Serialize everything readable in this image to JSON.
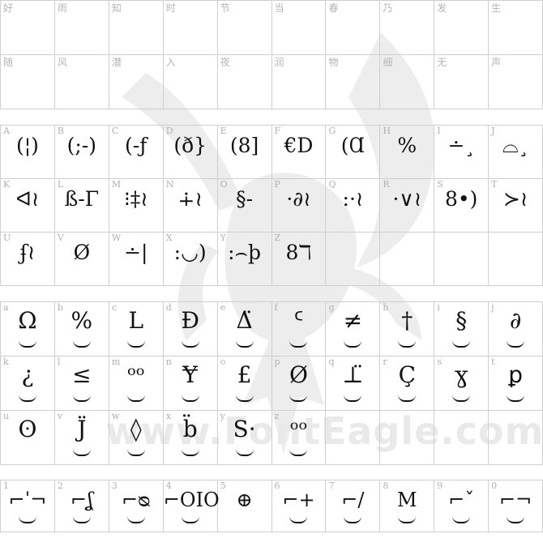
{
  "cjk_rows": [
    [
      "好",
      "雨",
      "知",
      "时",
      "节",
      "当",
      "春",
      "乃",
      "发",
      "生"
    ],
    [
      "随",
      "风",
      "潜",
      "入",
      "夜",
      "润",
      "物",
      "细",
      "无",
      "声"
    ]
  ],
  "upper_rows": [
    [
      {
        "l": "A",
        "g": "(¦)"
      },
      {
        "l": "B",
        "g": "(;-)"
      },
      {
        "l": "C",
        "g": "(-ƒ"
      },
      {
        "l": "D",
        "g": "(ð}"
      },
      {
        "l": "E",
        "g": "(8]"
      },
      {
        "l": "F",
        "g": "€D"
      },
      {
        "l": "G",
        "g": "(Ɑ"
      },
      {
        "l": "H",
        "g": "%"
      },
      {
        "l": "I",
        "g": "∸¸"
      },
      {
        "l": "J",
        "g": "⌓¸"
      }
    ],
    [
      {
        "l": "K",
        "g": "ᐊ≀"
      },
      {
        "l": "L",
        "g": "ß-Γ"
      },
      {
        "l": "M",
        "g": "⁝‡≀"
      },
      {
        "l": "N",
        "g": "∔≀"
      },
      {
        "l": "O",
        "g": "§-"
      },
      {
        "l": "P",
        "g": "·∂≀"
      },
      {
        "l": "Q",
        "g": ":·≀"
      },
      {
        "l": "R",
        "g": "·∨≀"
      },
      {
        "l": "S",
        "g": "8•)"
      },
      {
        "l": "T",
        "g": "≻≀"
      }
    ],
    [
      {
        "l": "U",
        "g": "ʄ≀"
      },
      {
        "l": "V",
        "g": "Ø"
      },
      {
        "l": "W",
        "g": "∸|"
      },
      {
        "l": "X",
        "g": ":◡)"
      },
      {
        "l": "Y",
        "g": ":⌢þ"
      },
      {
        "l": "Z",
        "g": "8ℸ"
      },
      {
        "l": "",
        "g": ""
      },
      {
        "l": "",
        "g": ""
      },
      {
        "l": "",
        "g": ""
      },
      {
        "l": "",
        "g": ""
      }
    ]
  ],
  "lower_rows": [
    [
      {
        "l": "a",
        "g": "Ω"
      },
      {
        "l": "b",
        "g": "%"
      },
      {
        "l": "c",
        "g": "L"
      },
      {
        "l": "d",
        "g": "Đ"
      },
      {
        "l": "e",
        "g": "Δ̈"
      },
      {
        "l": "f",
        "g": "ᑦ"
      },
      {
        "l": "g",
        "g": "≠"
      },
      {
        "l": "h",
        "g": "†"
      },
      {
        "l": "i",
        "g": "§"
      },
      {
        "l": "j",
        "g": "∂"
      }
    ],
    [
      {
        "l": "k",
        "g": "¿"
      },
      {
        "l": "l",
        "g": "≤"
      },
      {
        "l": "m",
        "g": "ᵒᵒ"
      },
      {
        "l": "n",
        "g": "Ɏ"
      },
      {
        "l": "o",
        "g": "£"
      },
      {
        "l": "p",
        "g": "Ø"
      },
      {
        "l": "q",
        "g": "⊥̈"
      },
      {
        "l": "r",
        "g": "Ç"
      },
      {
        "l": "s",
        "g": "ɣ"
      },
      {
        "l": "t",
        "g": "ꝑ"
      }
    ],
    [
      {
        "l": "u",
        "g": "ʘ"
      },
      {
        "l": "v",
        "g": "J̈"
      },
      {
        "l": "w",
        "g": "◊"
      },
      {
        "l": "x",
        "g": "b̈"
      },
      {
        "l": "y",
        "g": "S·"
      },
      {
        "l": "z",
        "g": "ᵒᵒ"
      },
      {
        "l": "",
        "g": ""
      },
      {
        "l": "",
        "g": ""
      },
      {
        "l": "",
        "g": ""
      },
      {
        "l": "",
        "g": ""
      }
    ]
  ],
  "digit_row": [
    {
      "l": "1",
      "g": "⌐ˈ¬"
    },
    {
      "l": "2",
      "g": "⌐ʆ"
    },
    {
      "l": "3",
      "g": "⌐ᴓ"
    },
    {
      "l": "4",
      "g": "⌐OIO"
    },
    {
      "l": "5",
      "g": "⊕"
    },
    {
      "l": "6",
      "g": "⌐+"
    },
    {
      "l": "7",
      "g": "⌐/"
    },
    {
      "l": "8",
      "g": "M"
    },
    {
      "l": "9",
      "g": "⌐ˇ"
    },
    {
      "l": "0",
      "g": "⌐¬"
    }
  ],
  "watermark": "www.FontEagle.com"
}
